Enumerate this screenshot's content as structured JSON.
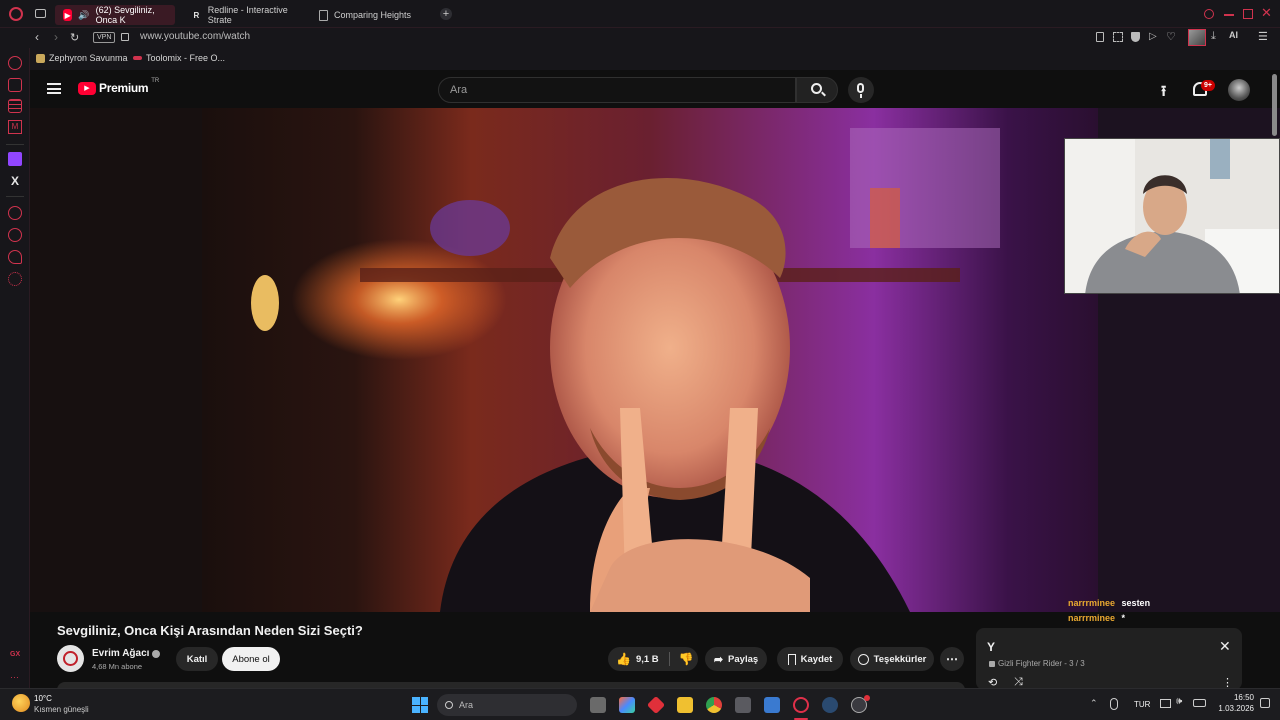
{
  "browser": {
    "tabs": [
      {
        "label": "(62) Sevgiliniz, Onca K",
        "active": true
      },
      {
        "label": "Redline - Interactive Strate",
        "active": false
      },
      {
        "label": "Comparing Heights",
        "active": false
      }
    ],
    "vpn_label": "VPN",
    "url": "www.youtube.com/watch",
    "ai_label": "AI",
    "bookmarks": [
      {
        "label": "Zephyron Savunma"
      },
      {
        "label": "Toolomix - Free O..."
      }
    ],
    "sidebar_bottom_label": "GX"
  },
  "youtube": {
    "logo_label": "Premium",
    "logo_region": "TR",
    "search_placeholder": "Ara",
    "notification_count": "9+",
    "video": {
      "title": "Sevgiliniz, Onca Kişi Arasından Neden Sizi Seçti?",
      "channel_name": "Evrim Ağacı",
      "subscribers": "4,68 Mn abone",
      "join_label": "Katıl",
      "subscribe_label": "Abone ol",
      "likes": "9,1 B",
      "share_label": "Paylaş",
      "save_label": "Kaydet",
      "thanks_label": "Teşekkürler"
    },
    "chat": [
      {
        "user": "narrrminee",
        "message": "sesten"
      },
      {
        "user": "narrrminee",
        "message": "*"
      }
    ],
    "miniplayer": {
      "title": "Y",
      "subtitle": "Gizli  Fighter Rider - 3 / 3"
    }
  },
  "taskbar": {
    "weather_temp": "10°C",
    "weather_desc": "Kısmen güneşli",
    "search_placeholder": "Ara",
    "language": "TUR",
    "time": "16:50",
    "date": "1.03.2026"
  },
  "colors": {
    "accent": "#d0334e",
    "youtube_red": "#ff0033"
  }
}
